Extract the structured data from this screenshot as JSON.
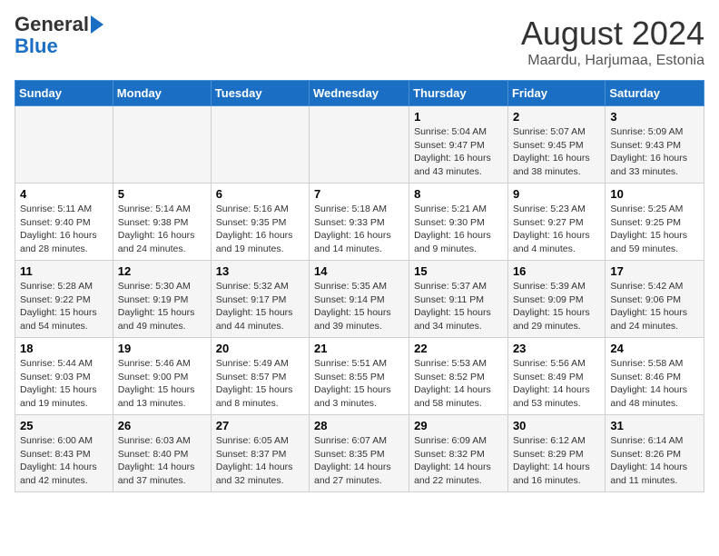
{
  "header": {
    "logo_line1": "General",
    "logo_line2": "Blue",
    "title": "August 2024",
    "subtitle": "Maardu, Harjumaa, Estonia"
  },
  "weekdays": [
    "Sunday",
    "Monday",
    "Tuesday",
    "Wednesday",
    "Thursday",
    "Friday",
    "Saturday"
  ],
  "weeks": [
    [
      {
        "day": "",
        "info": ""
      },
      {
        "day": "",
        "info": ""
      },
      {
        "day": "",
        "info": ""
      },
      {
        "day": "",
        "info": ""
      },
      {
        "day": "1",
        "info": "Sunrise: 5:04 AM\nSunset: 9:47 PM\nDaylight: 16 hours and 43 minutes."
      },
      {
        "day": "2",
        "info": "Sunrise: 5:07 AM\nSunset: 9:45 PM\nDaylight: 16 hours and 38 minutes."
      },
      {
        "day": "3",
        "info": "Sunrise: 5:09 AM\nSunset: 9:43 PM\nDaylight: 16 hours and 33 minutes."
      }
    ],
    [
      {
        "day": "4",
        "info": "Sunrise: 5:11 AM\nSunset: 9:40 PM\nDaylight: 16 hours and 28 minutes."
      },
      {
        "day": "5",
        "info": "Sunrise: 5:14 AM\nSunset: 9:38 PM\nDaylight: 16 hours and 24 minutes."
      },
      {
        "day": "6",
        "info": "Sunrise: 5:16 AM\nSunset: 9:35 PM\nDaylight: 16 hours and 19 minutes."
      },
      {
        "day": "7",
        "info": "Sunrise: 5:18 AM\nSunset: 9:33 PM\nDaylight: 16 hours and 14 minutes."
      },
      {
        "day": "8",
        "info": "Sunrise: 5:21 AM\nSunset: 9:30 PM\nDaylight: 16 hours and 9 minutes."
      },
      {
        "day": "9",
        "info": "Sunrise: 5:23 AM\nSunset: 9:27 PM\nDaylight: 16 hours and 4 minutes."
      },
      {
        "day": "10",
        "info": "Sunrise: 5:25 AM\nSunset: 9:25 PM\nDaylight: 15 hours and 59 minutes."
      }
    ],
    [
      {
        "day": "11",
        "info": "Sunrise: 5:28 AM\nSunset: 9:22 PM\nDaylight: 15 hours and 54 minutes."
      },
      {
        "day": "12",
        "info": "Sunrise: 5:30 AM\nSunset: 9:19 PM\nDaylight: 15 hours and 49 minutes."
      },
      {
        "day": "13",
        "info": "Sunrise: 5:32 AM\nSunset: 9:17 PM\nDaylight: 15 hours and 44 minutes."
      },
      {
        "day": "14",
        "info": "Sunrise: 5:35 AM\nSunset: 9:14 PM\nDaylight: 15 hours and 39 minutes."
      },
      {
        "day": "15",
        "info": "Sunrise: 5:37 AM\nSunset: 9:11 PM\nDaylight: 15 hours and 34 minutes."
      },
      {
        "day": "16",
        "info": "Sunrise: 5:39 AM\nSunset: 9:09 PM\nDaylight: 15 hours and 29 minutes."
      },
      {
        "day": "17",
        "info": "Sunrise: 5:42 AM\nSunset: 9:06 PM\nDaylight: 15 hours and 24 minutes."
      }
    ],
    [
      {
        "day": "18",
        "info": "Sunrise: 5:44 AM\nSunset: 9:03 PM\nDaylight: 15 hours and 19 minutes."
      },
      {
        "day": "19",
        "info": "Sunrise: 5:46 AM\nSunset: 9:00 PM\nDaylight: 15 hours and 13 minutes."
      },
      {
        "day": "20",
        "info": "Sunrise: 5:49 AM\nSunset: 8:57 PM\nDaylight: 15 hours and 8 minutes."
      },
      {
        "day": "21",
        "info": "Sunrise: 5:51 AM\nSunset: 8:55 PM\nDaylight: 15 hours and 3 minutes."
      },
      {
        "day": "22",
        "info": "Sunrise: 5:53 AM\nSunset: 8:52 PM\nDaylight: 14 hours and 58 minutes."
      },
      {
        "day": "23",
        "info": "Sunrise: 5:56 AM\nSunset: 8:49 PM\nDaylight: 14 hours and 53 minutes."
      },
      {
        "day": "24",
        "info": "Sunrise: 5:58 AM\nSunset: 8:46 PM\nDaylight: 14 hours and 48 minutes."
      }
    ],
    [
      {
        "day": "25",
        "info": "Sunrise: 6:00 AM\nSunset: 8:43 PM\nDaylight: 14 hours and 42 minutes."
      },
      {
        "day": "26",
        "info": "Sunrise: 6:03 AM\nSunset: 8:40 PM\nDaylight: 14 hours and 37 minutes."
      },
      {
        "day": "27",
        "info": "Sunrise: 6:05 AM\nSunset: 8:37 PM\nDaylight: 14 hours and 32 minutes."
      },
      {
        "day": "28",
        "info": "Sunrise: 6:07 AM\nSunset: 8:35 PM\nDaylight: 14 hours and 27 minutes."
      },
      {
        "day": "29",
        "info": "Sunrise: 6:09 AM\nSunset: 8:32 PM\nDaylight: 14 hours and 22 minutes."
      },
      {
        "day": "30",
        "info": "Sunrise: 6:12 AM\nSunset: 8:29 PM\nDaylight: 14 hours and 16 minutes."
      },
      {
        "day": "31",
        "info": "Sunrise: 6:14 AM\nSunset: 8:26 PM\nDaylight: 14 hours and 11 minutes."
      }
    ]
  ]
}
